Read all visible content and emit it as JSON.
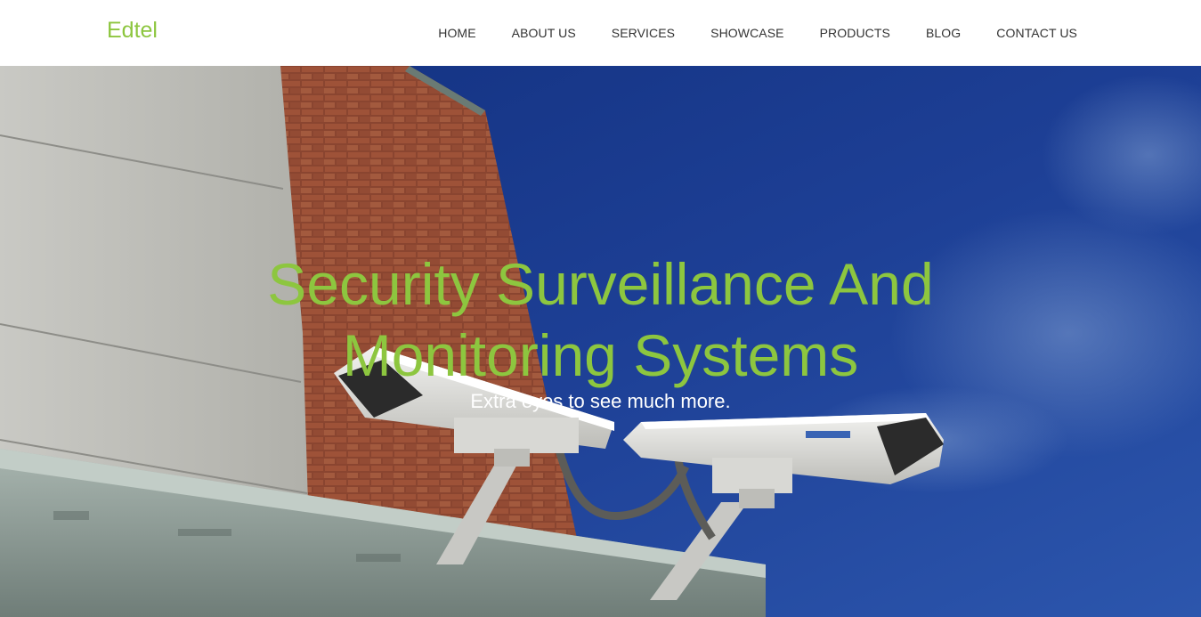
{
  "header": {
    "logo": "Edtel",
    "nav": [
      {
        "label": "HOME"
      },
      {
        "label": "ABOUT US"
      },
      {
        "label": "SERVICES"
      },
      {
        "label": "SHOWCASE"
      },
      {
        "label": "PRODUCTS"
      },
      {
        "label": "BLOG"
      },
      {
        "label": "CONTACT US"
      }
    ]
  },
  "hero": {
    "title_line1": "Security Surveillance And",
    "title_line2": "Monitoring Systems",
    "subtitle": "Extra eyes to see much more."
  },
  "colors": {
    "accent": "#8dc63f",
    "nav_text": "#333333",
    "sky": "#1f3f8f"
  }
}
